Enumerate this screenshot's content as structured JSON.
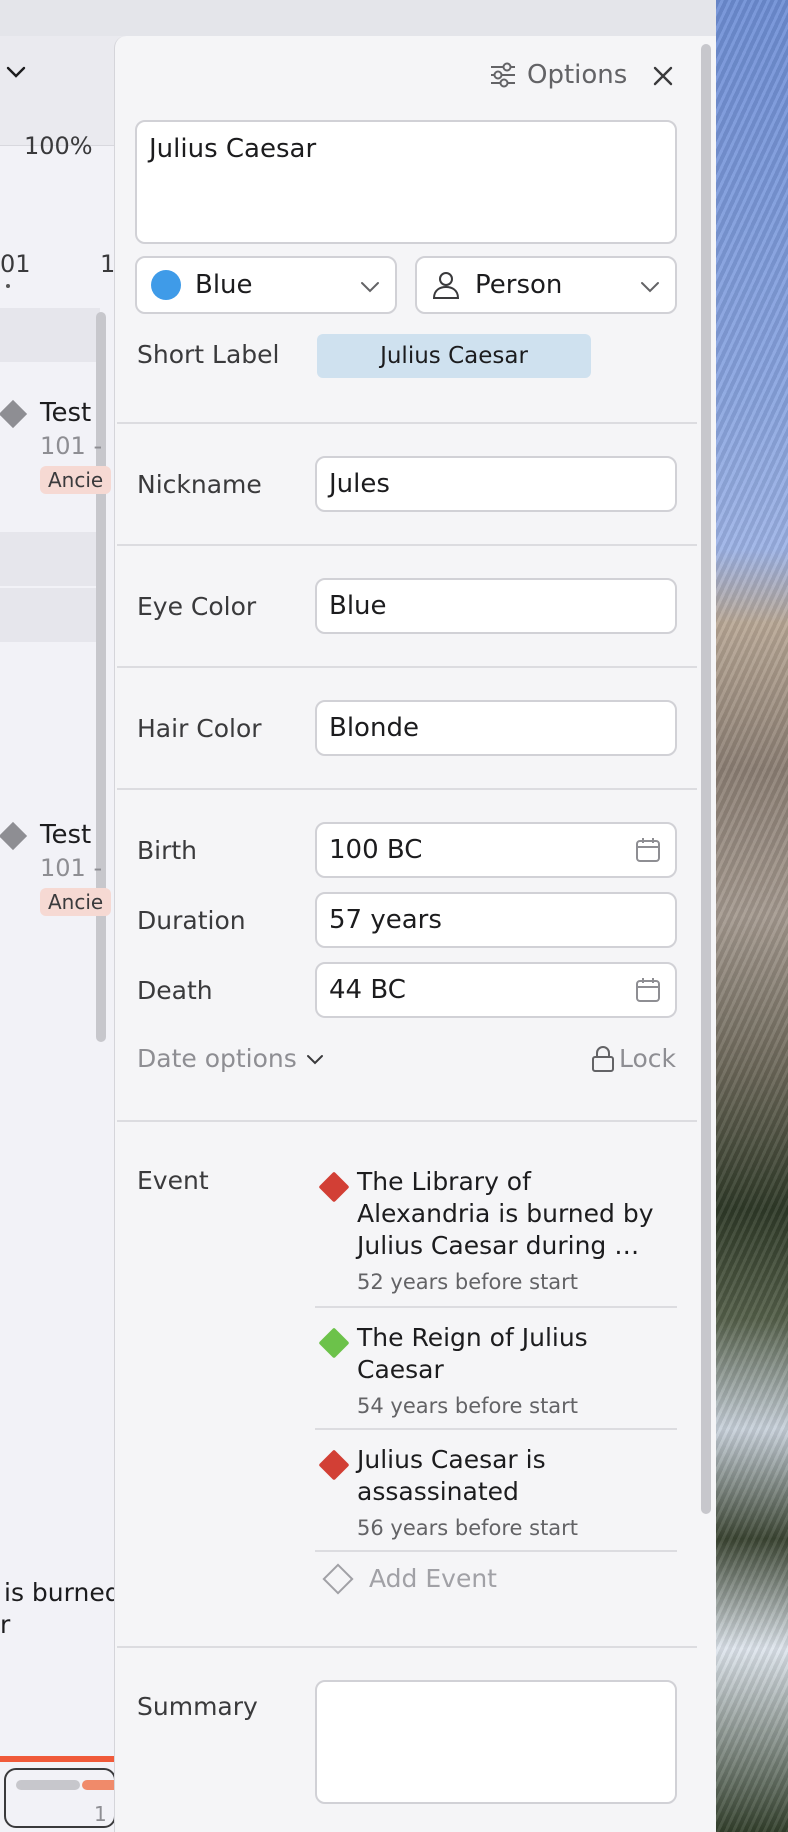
{
  "timeline": {
    "zoom": "100%",
    "ticks": [
      "01",
      "1"
    ],
    "items": [
      {
        "name": "Test",
        "sub": "101 -",
        "tag": "Ancie"
      },
      {
        "name": "Test",
        "sub": "101 -",
        "tag": "Ancie"
      }
    ],
    "fragment_line1": "is burned",
    "fragment_line2": "r",
    "minimap_number": "1"
  },
  "panel": {
    "options_label": "Options",
    "name": "Julius Caesar",
    "color": {
      "label": "Blue",
      "value": "#3f9be8"
    },
    "type": {
      "label": "Person",
      "icon": "person-icon"
    },
    "short_label": {
      "label": "Short Label",
      "value": "Julius Caesar"
    },
    "fields": [
      {
        "label": "Nickname",
        "value": "Jules"
      },
      {
        "label": "Eye Color",
        "value": "Blue"
      },
      {
        "label": "Hair Color",
        "value": "Blonde"
      }
    ],
    "dates": {
      "birth": {
        "label": "Birth",
        "value": "100 BC"
      },
      "duration": {
        "label": "Duration",
        "value": "57 years"
      },
      "death": {
        "label": "Death",
        "value": "44 BC"
      },
      "options_label": "Date options",
      "lock_label": "Lock"
    },
    "events": {
      "label": "Event",
      "items": [
        {
          "title": "The Library of Alexandria is burned by Julius Caesar during …",
          "relative": "52 years before start",
          "color": "#d23f35"
        },
        {
          "title": "The Reign of Julius Caesar",
          "relative": "54 years before start",
          "color": "#6cc24a"
        },
        {
          "title": "Julius Caesar is assassinated",
          "relative": "56 years before start",
          "color": "#d23f35"
        }
      ],
      "add_label": "Add Event"
    },
    "summary_label": "Summary",
    "summary_value": ""
  }
}
